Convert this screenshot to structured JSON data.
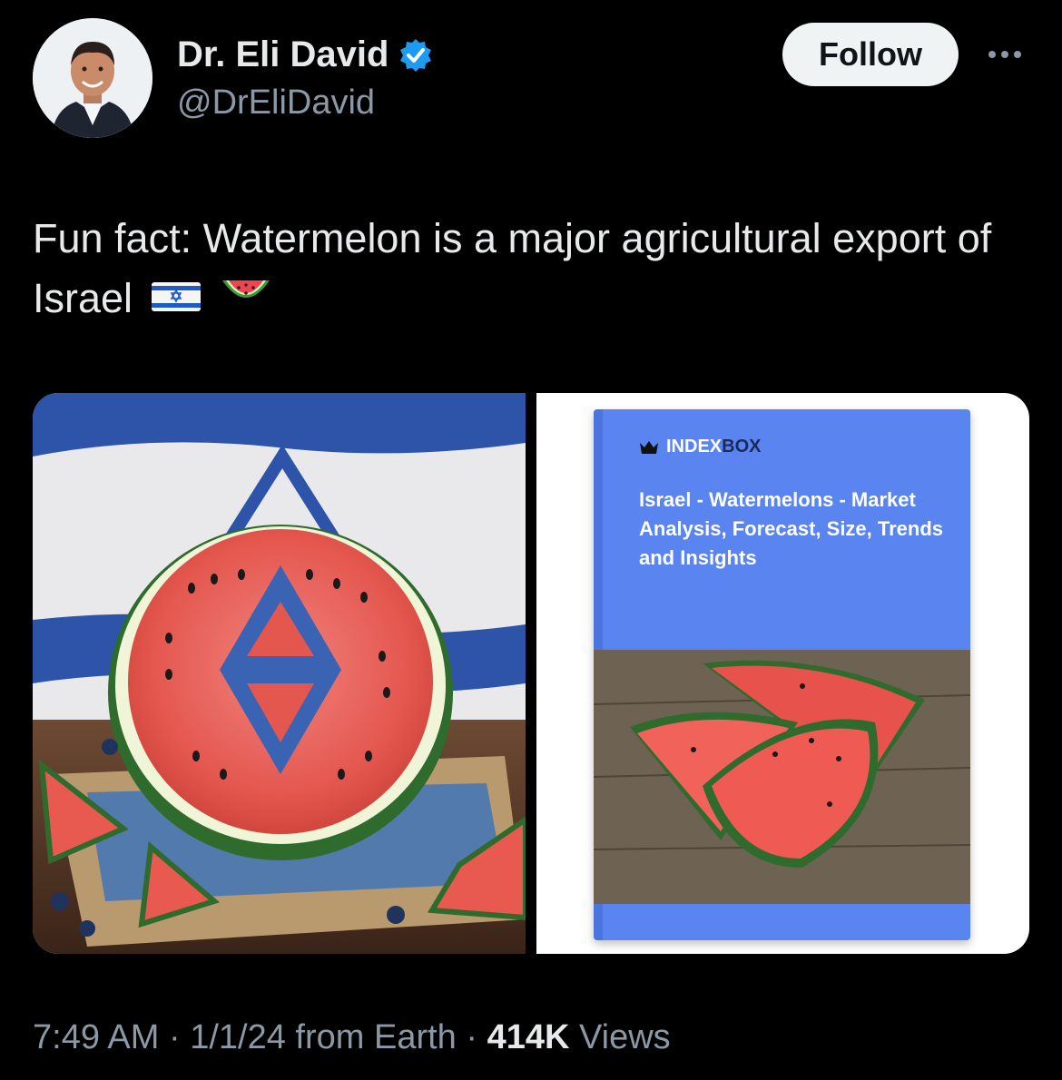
{
  "author": {
    "display_name": "Dr. Eli David",
    "handle": "@DrEliDavid",
    "verified": true,
    "verified_color": "#1d9bf0"
  },
  "actions": {
    "follow_label": "Follow",
    "more_icon": "more-horizontal-icon"
  },
  "tweet": {
    "text": "Fun fact: Watermelon is a major agricultural export of Israel",
    "emojis": [
      "israel-flag-emoji",
      "watermelon-emoji"
    ]
  },
  "media": {
    "left_image": "israeli-flag-with-star-carved-watermelon",
    "right_image": {
      "brand_index": "INDEX",
      "brand_box": "BOX",
      "title": "Israel - Watermelons - Market Analysis, Forecast, Size, Trends and Insights",
      "cover_color": "#5a84f0"
    }
  },
  "meta": {
    "time": "7:49 AM",
    "separator": " · ",
    "date": "1/1/24",
    "from": " from Earth",
    "views_count": "414K",
    "views_label": " Views"
  }
}
